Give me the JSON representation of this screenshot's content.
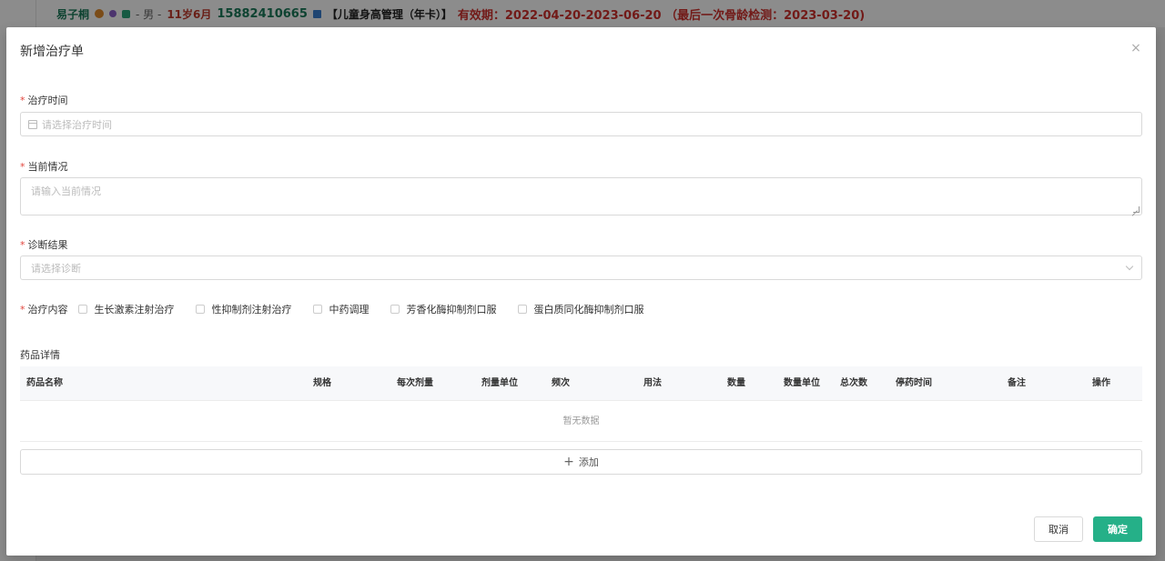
{
  "background": {
    "patient_name": "易子桐",
    "gender_age": "- 男 - ",
    "age": "11岁6月",
    "phone": "15882410665",
    "plan": "【儿童身高管理（年卡）】",
    "validity": "有效期：2022-04-20-2023-06-20 （最后一次骨龄检测：2023-03-20)"
  },
  "modal": {
    "title": "新增治疗单",
    "close": "×"
  },
  "form": {
    "treatment_time": {
      "label": "治疗时间",
      "placeholder": "请选择治疗时间"
    },
    "current_status": {
      "label": "当前情况",
      "placeholder": "请输入当前情况"
    },
    "diagnosis": {
      "label": "诊断结果",
      "placeholder": "请选择诊断"
    },
    "treatment_content": {
      "label": "治疗内容",
      "options": [
        "生长激素注射治疗",
        "性抑制剂注射治疗",
        "中药调理",
        "芳香化酶抑制剂口服",
        "蛋白质同化酶抑制剂口服"
      ]
    }
  },
  "drug_details": {
    "label": "药品详情",
    "columns": [
      "药品名称",
      "规格",
      "每次剂量",
      "剂量单位",
      "频次",
      "用法",
      "数量",
      "数量单位",
      "总次数",
      "停药时间",
      "备注",
      "操作"
    ],
    "empty_text": "暂无数据",
    "add_label": "添加"
  },
  "footer": {
    "cancel": "取消",
    "confirm": "确定"
  },
  "colors": {
    "primary": "#25b088",
    "required": "#e2453c",
    "name_green": "#1a7a5a",
    "validity_red": "#d0312d"
  }
}
